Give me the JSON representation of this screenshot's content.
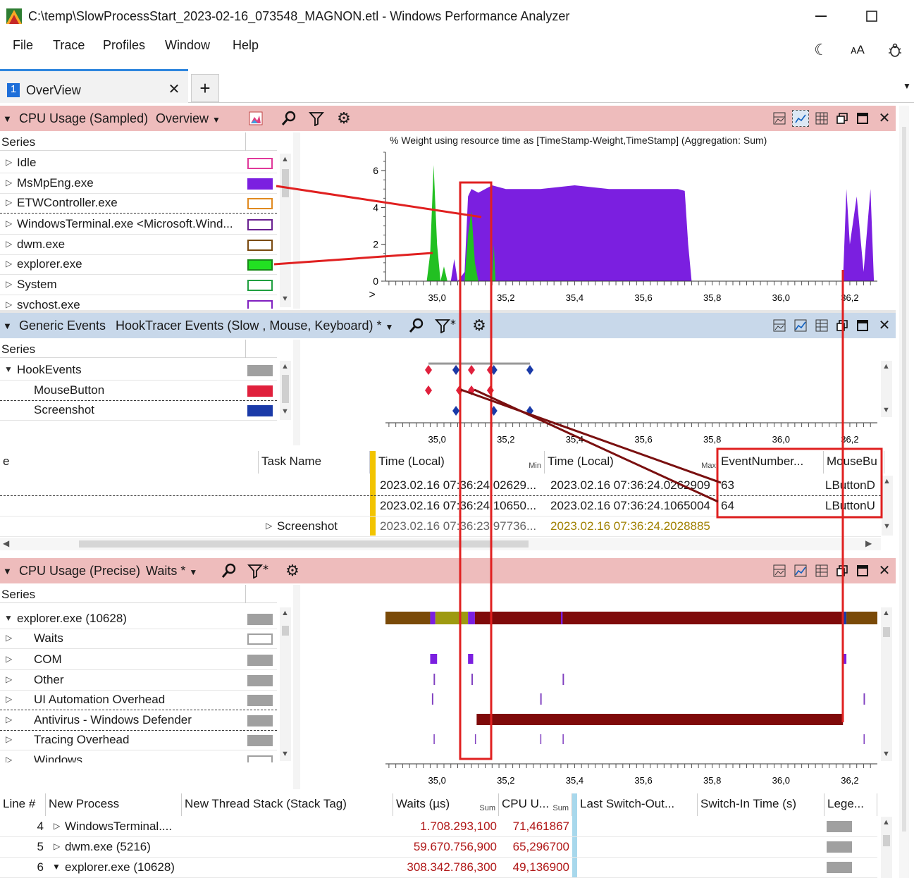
{
  "window": {
    "title": "C:\\temp\\SlowProcessStart_2023-02-16_073548_MAGNON.etl - Windows Performance Analyzer"
  },
  "menu": [
    "File",
    "Trace",
    "Profiles",
    "Window",
    "Help"
  ],
  "tabs": [
    {
      "number": "1",
      "label": "OverView"
    }
  ],
  "panel1": {
    "title": "CPU Usage (Sampled)",
    "preset": "Overview",
    "series_header": "Series",
    "chart_title": "% Weight using resource time as [TimeStamp-Weight,TimeStamp] (Aggregation: Sum)",
    "series": [
      {
        "label": "Idle",
        "color": "#e0389a"
      },
      {
        "label": "MsMpEng.exe",
        "color": "#7b1fe0"
      },
      {
        "label": "ETWController.exe",
        "color": "#e08a20"
      },
      {
        "label": "WindowsTerminal.exe <Microsoft.Wind...",
        "color": "#6a2090"
      },
      {
        "label": "dwm.exe",
        "color": "#7a4a10"
      },
      {
        "label": "explorer.exe",
        "color": "#22c022"
      },
      {
        "label": "System",
        "color": "#20a040"
      },
      {
        "label": "svchost.exe",
        "color": "#8020c0"
      }
    ]
  },
  "chart_data": {
    "type": "area",
    "title": "% Weight using resource time as [TimeStamp-Weight,TimeStamp] (Aggregation: Sum)",
    "xlim": [
      34.85,
      36.28
    ],
    "ylim": [
      0,
      7
    ],
    "x_ticks": [
      "35,0",
      "35,2",
      "35,4",
      "35,6",
      "35,8",
      "36,0",
      "36,2"
    ],
    "y_ticks": [
      "0",
      "2",
      "4",
      "6"
    ],
    "series": [
      {
        "name": "MsMpEng.exe",
        "color": "#7b1fe0",
        "x": [
          35.04,
          35.05,
          35.06,
          35.08,
          35.09,
          35.1,
          35.12,
          35.14,
          35.16,
          35.2,
          35.3,
          35.4,
          35.5,
          35.6,
          35.65,
          35.7,
          35.72,
          35.73,
          35.74,
          36.18,
          36.19,
          36.2,
          36.22,
          36.24,
          36.26,
          36.27
        ],
        "y": [
          0,
          1.2,
          0,
          0.5,
          4.6,
          5.0,
          4.8,
          5.0,
          5.2,
          5.0,
          5.0,
          5.2,
          5.0,
          5.0,
          5.0,
          5.0,
          4.9,
          2.0,
          0,
          0,
          5.0,
          2.0,
          4.6,
          0.5,
          5.0,
          0
        ]
      },
      {
        "name": "explorer.exe",
        "color": "#22c022",
        "x": [
          34.97,
          34.98,
          34.99,
          35.0,
          35.01,
          35.02,
          35.03,
          35.08,
          35.09,
          35.1,
          35.11,
          35.12,
          35.13,
          35.16,
          35.165,
          35.17
        ],
        "y": [
          0,
          1.5,
          6.3,
          2.0,
          0,
          0.8,
          0,
          0,
          2.5,
          3.8,
          1.0,
          0,
          0,
          0,
          2.0,
          0
        ]
      }
    ]
  },
  "panel2": {
    "title": "Generic Events",
    "preset": "HookTracer Events (Slow , Mouse, Keyboard) *",
    "series_header": "Series",
    "series": [
      {
        "label": "HookEvents",
        "color": "#a0a0a0"
      },
      {
        "label": "MouseButton",
        "color": "#e0203c"
      },
      {
        "label": "Screenshot",
        "color": "#1a3aa8"
      }
    ],
    "x_ticks": [
      "35,0",
      "35,2",
      "35,4",
      "35,6",
      "35,8",
      "36,0",
      "36,2"
    ],
    "table": {
      "headers": [
        "e",
        "Task Name",
        "Time (Local)",
        "Min",
        "Time (Local)",
        "Max",
        "EventNumber...",
        "MouseBu"
      ],
      "rows": [
        [
          "",
          "",
          "2023.02.16 07:36:24.02629...",
          "2023.02.16 07:36:24.0262909",
          "63",
          "LButtonD"
        ],
        [
          "",
          "",
          "2023.02.16 07:36:24.10650...",
          "2023.02.16 07:36:24.1065004",
          "64",
          "LButtonU"
        ],
        [
          "",
          "Screenshot",
          "2023.02.16 07:36:23.97736...",
          "2023.02.16 07:36:24.2028885",
          "",
          ""
        ]
      ]
    }
  },
  "panel3": {
    "title": "CPU Usage (Precise)",
    "preset": "Waits *",
    "series_header": "Series",
    "series": [
      {
        "label": "explorer.exe (10628)",
        "color": "#a0a0a0"
      },
      {
        "label": "Waits",
        "color": "#ffffff"
      },
      {
        "label": "COM",
        "color": "#a0a0a0"
      },
      {
        "label": "Other",
        "color": "#a0a0a0"
      },
      {
        "label": "UI Automation Overhead",
        "color": "#a0a0a0"
      },
      {
        "label": "Antivirus - Windows Defender",
        "color": "#a0a0a0"
      },
      {
        "label": "Tracing Overhead",
        "color": "#a0a0a0"
      },
      {
        "label": "Windows",
        "color": "#ffffff"
      }
    ],
    "x_ticks": [
      "35,0",
      "35,2",
      "35,4",
      "35,6",
      "35,8",
      "36,0",
      "36,2"
    ],
    "table": {
      "headers": [
        "Line #",
        "New Process",
        "New Thread Stack (Stack Tag)",
        "Waits (µs)",
        "Sum",
        "CPU U...",
        "Sum",
        "Last Switch-Out...",
        "Switch-In Time (s)",
        "Lege..."
      ],
      "rows": [
        {
          "line": "4",
          "process": "WindowsTerminal....",
          "waits": "1.708.293,100",
          "cpu": "71,461867"
        },
        {
          "line": "5",
          "process": "dwm.exe (5216)",
          "waits": "59.670.756,900",
          "cpu": "65,296700"
        },
        {
          "line": "6",
          "process": "explorer.exe (10628)",
          "waits": "308.342.786,300",
          "cpu": "49,136900"
        }
      ]
    }
  }
}
